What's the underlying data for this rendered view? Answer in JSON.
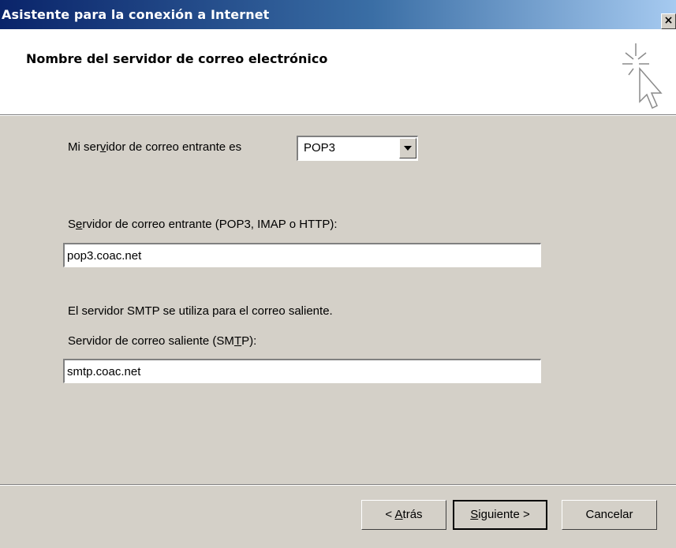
{
  "window": {
    "title": "Asistente para la conexión a Internet",
    "close_label": "×"
  },
  "header": {
    "title": "Nombre del servidor de correo electrónico",
    "icon": "wizard-sparkle-cursor-icon"
  },
  "form": {
    "incoming_type": {
      "label_pre": "Mi ser",
      "label_accel": "v",
      "label_post": "idor de correo entrante es",
      "value": "POP3"
    },
    "incoming_server": {
      "label_pre": "S",
      "label_accel": "e",
      "label_post": "rvidor de correo entrante (POP3, IMAP o HTTP):",
      "value": "pop3.coac.net"
    },
    "smtp_note": "El servidor SMTP se utiliza para el correo saliente.",
    "outgoing_server": {
      "label_pre": "Servidor de correo saliente (SM",
      "label_accel": "T",
      "label_post": "P):",
      "value": "smtp.coac.net"
    }
  },
  "buttons": {
    "back": {
      "pre": "< ",
      "accel": "A",
      "post": "trás"
    },
    "next": {
      "pre": "",
      "accel": "S",
      "post": "iguiente >"
    },
    "cancel": "Cancelar"
  }
}
